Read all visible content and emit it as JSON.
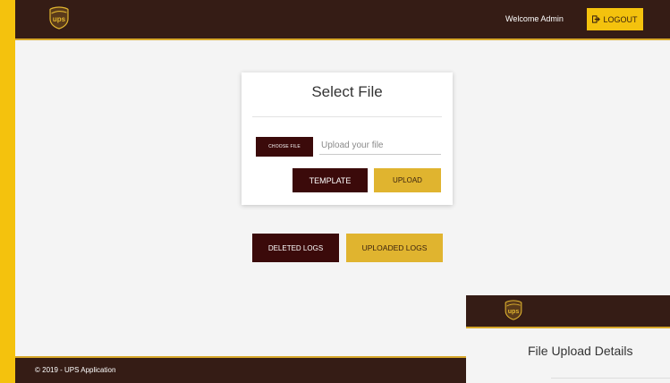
{
  "header": {
    "welcome_text": "Welcome Admin",
    "logout_label": "LOGOUT"
  },
  "logo": {
    "icon": "ups-shield-icon",
    "text": "ups"
  },
  "upload_card": {
    "title": "Select File",
    "choose_file_label": "CHOOSE FILE",
    "file_input_placeholder": "Upload your file",
    "template_label": "TEMPLATE",
    "upload_label": "UPLOAD"
  },
  "logs": {
    "deleted_label": "DELETED LOGS",
    "uploaded_label": "UPLOADED LOGS"
  },
  "footer": {
    "text": "© 2019 - UPS Application"
  },
  "second_window": {
    "title": "File Upload Details"
  },
  "colors": {
    "brown": "#351c15",
    "gold": "#e0b42f",
    "dark_button": "#3b0a0a",
    "yellow_accent": "#f4c20d"
  }
}
